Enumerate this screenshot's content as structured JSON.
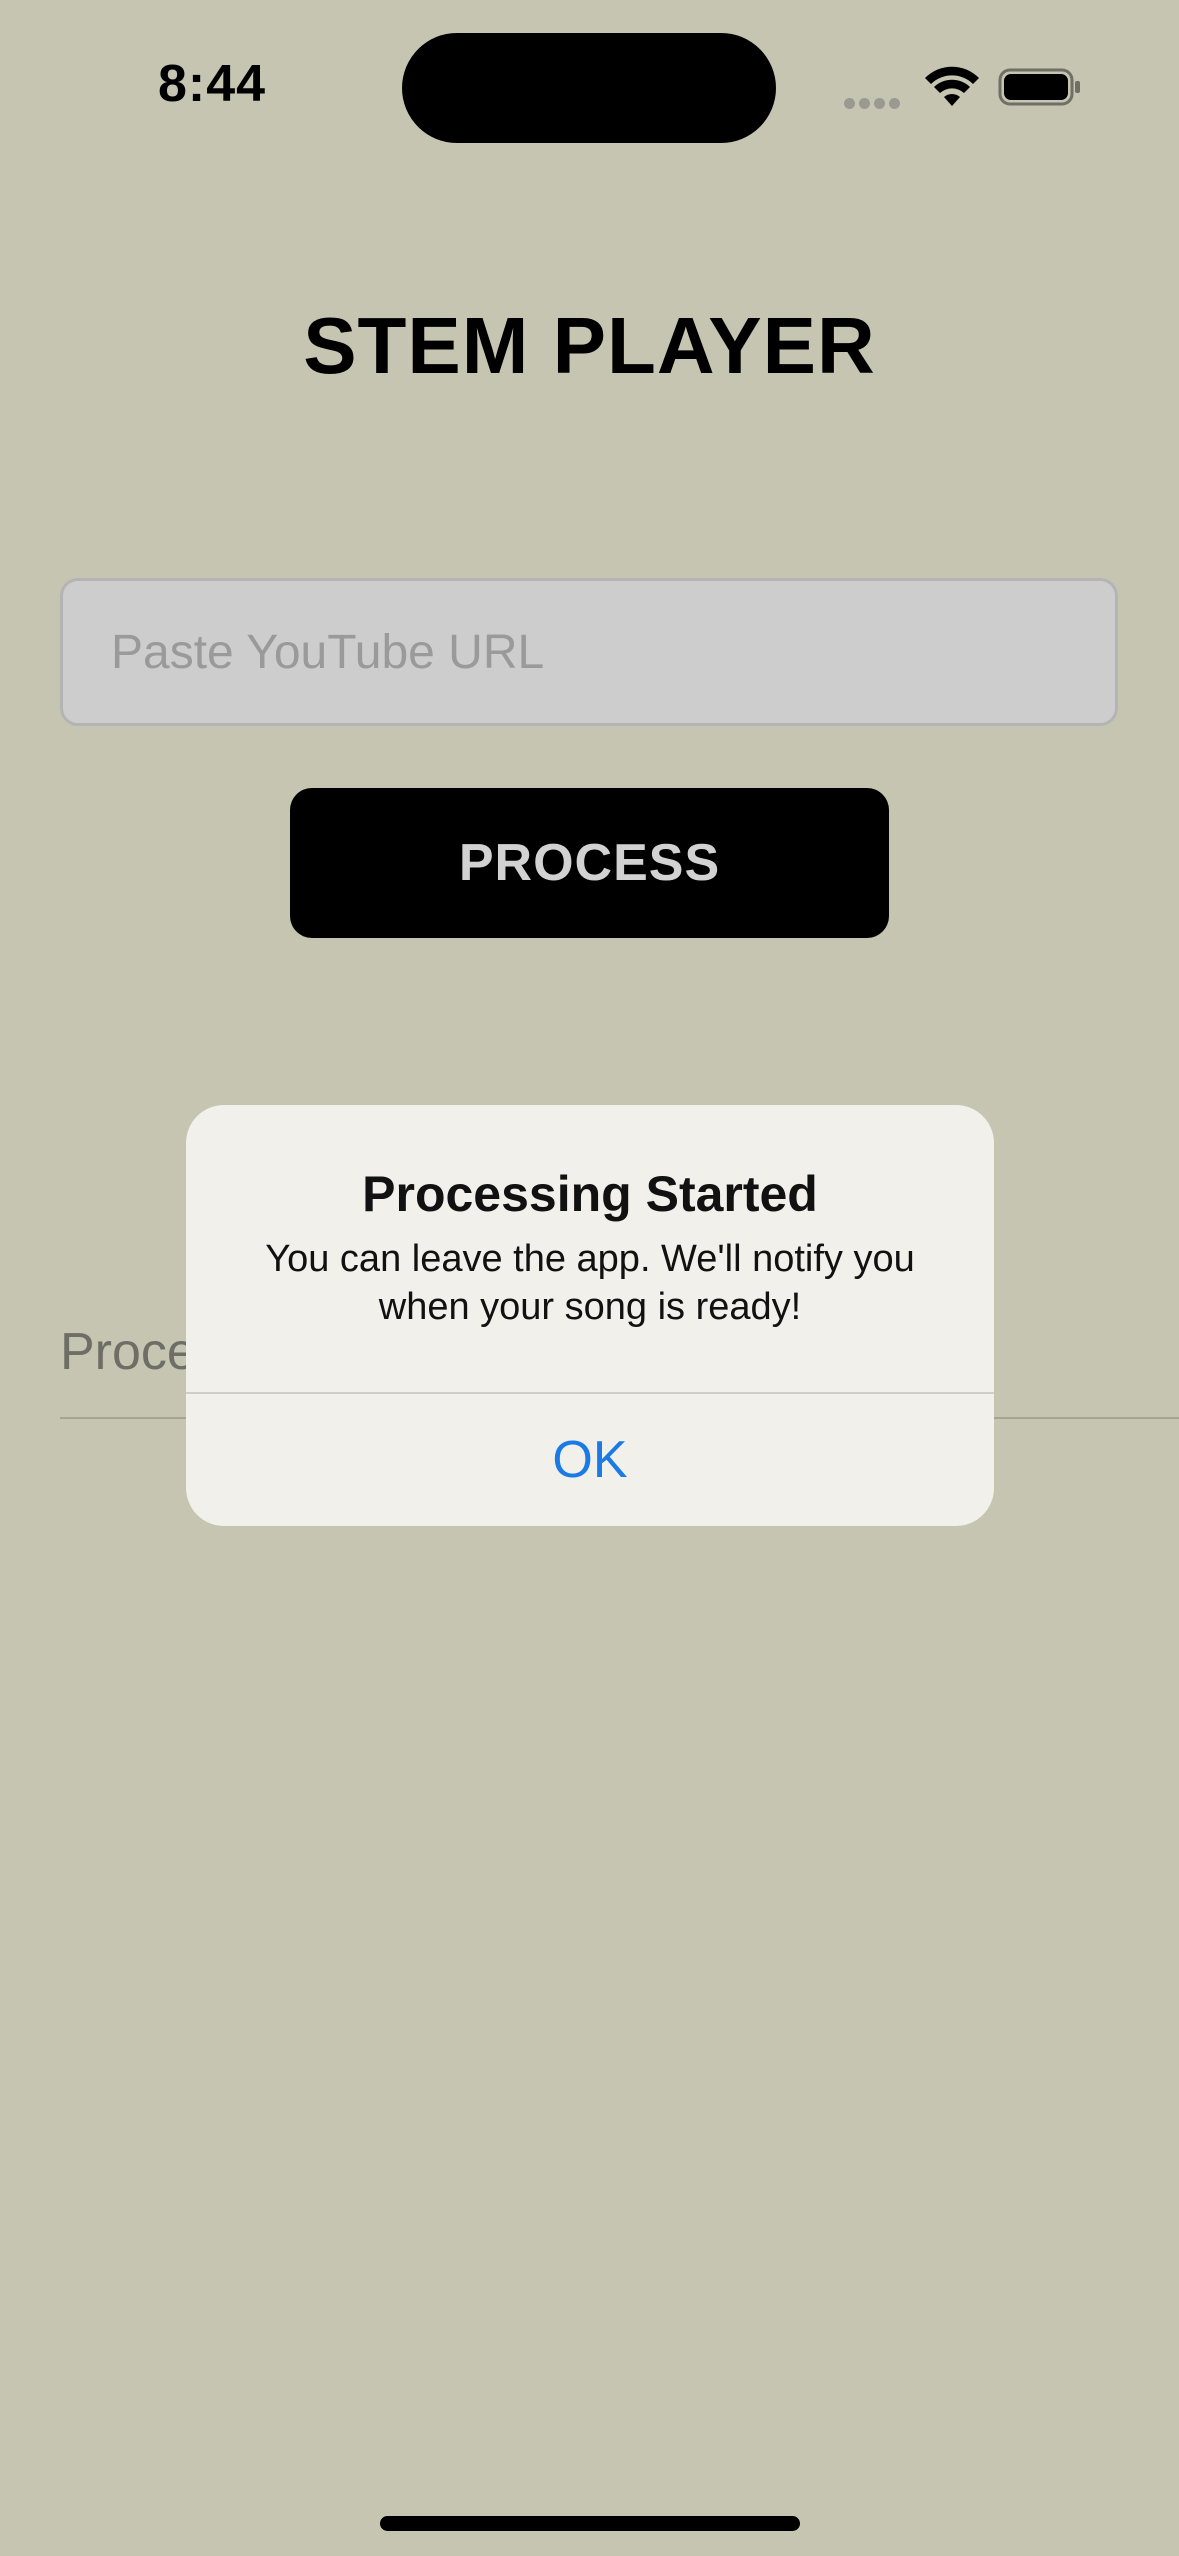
{
  "status_bar": {
    "time": "8:44",
    "icons": [
      "signal-dots-icon",
      "wifi-icon",
      "battery-icon"
    ]
  },
  "app": {
    "title": "STEM PLAYER"
  },
  "url_input": {
    "placeholder": "Paste YouTube URL",
    "value": ""
  },
  "process_button": {
    "label": "PROCESS"
  },
  "status_text": "Proce",
  "alert": {
    "title": "Processing Started",
    "message": "You can leave the app. We'll notify you when your song is ready!",
    "ok_label": "OK"
  },
  "colors": {
    "background": "#c6c5b1",
    "alert_background": "#f1f0ea",
    "accent": "#1a7ae6",
    "button_background": "#000000"
  }
}
